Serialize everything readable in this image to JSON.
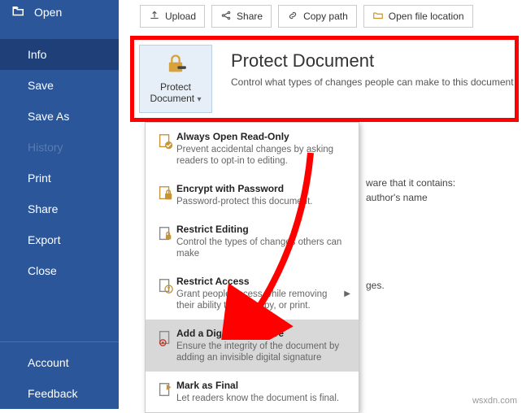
{
  "sidebar": {
    "open_label": "Open",
    "items": [
      "Info",
      "Save",
      "Save As",
      "History",
      "Print",
      "Share",
      "Export",
      "Close"
    ],
    "disabled": [
      "History"
    ],
    "selected": "Info",
    "bottom": [
      "Account",
      "Feedback"
    ]
  },
  "toolbar": {
    "upload": "Upload",
    "share": "Share",
    "copypath": "Copy path",
    "openloc": "Open file location"
  },
  "protect": {
    "button_l1": "Protect",
    "button_l2": "Document",
    "title": "Protect Document",
    "desc": "Control what types of changes people can make to this document"
  },
  "bg": {
    "line1": "ware that it contains:",
    "line2": "author's name",
    "line3": "ges."
  },
  "menu": {
    "items": [
      {
        "title": "Always Open Read-Only",
        "desc": "Prevent accidental changes by asking readers to opt-in to editing."
      },
      {
        "title": "Encrypt with Password",
        "desc": "Password-protect this document."
      },
      {
        "title": "Restrict Editing",
        "desc": "Control the types of changes others can make"
      },
      {
        "title": "Restrict Access",
        "desc": "Grant people access while removing their ability to edit, copy, or print."
      },
      {
        "title": "Add a Digital Signature",
        "desc": "Ensure the integrity of the document by adding an invisible digital signature"
      },
      {
        "title": "Mark as Final",
        "desc": "Let readers know the document is final."
      }
    ]
  },
  "watermark": "wsxdn.com"
}
